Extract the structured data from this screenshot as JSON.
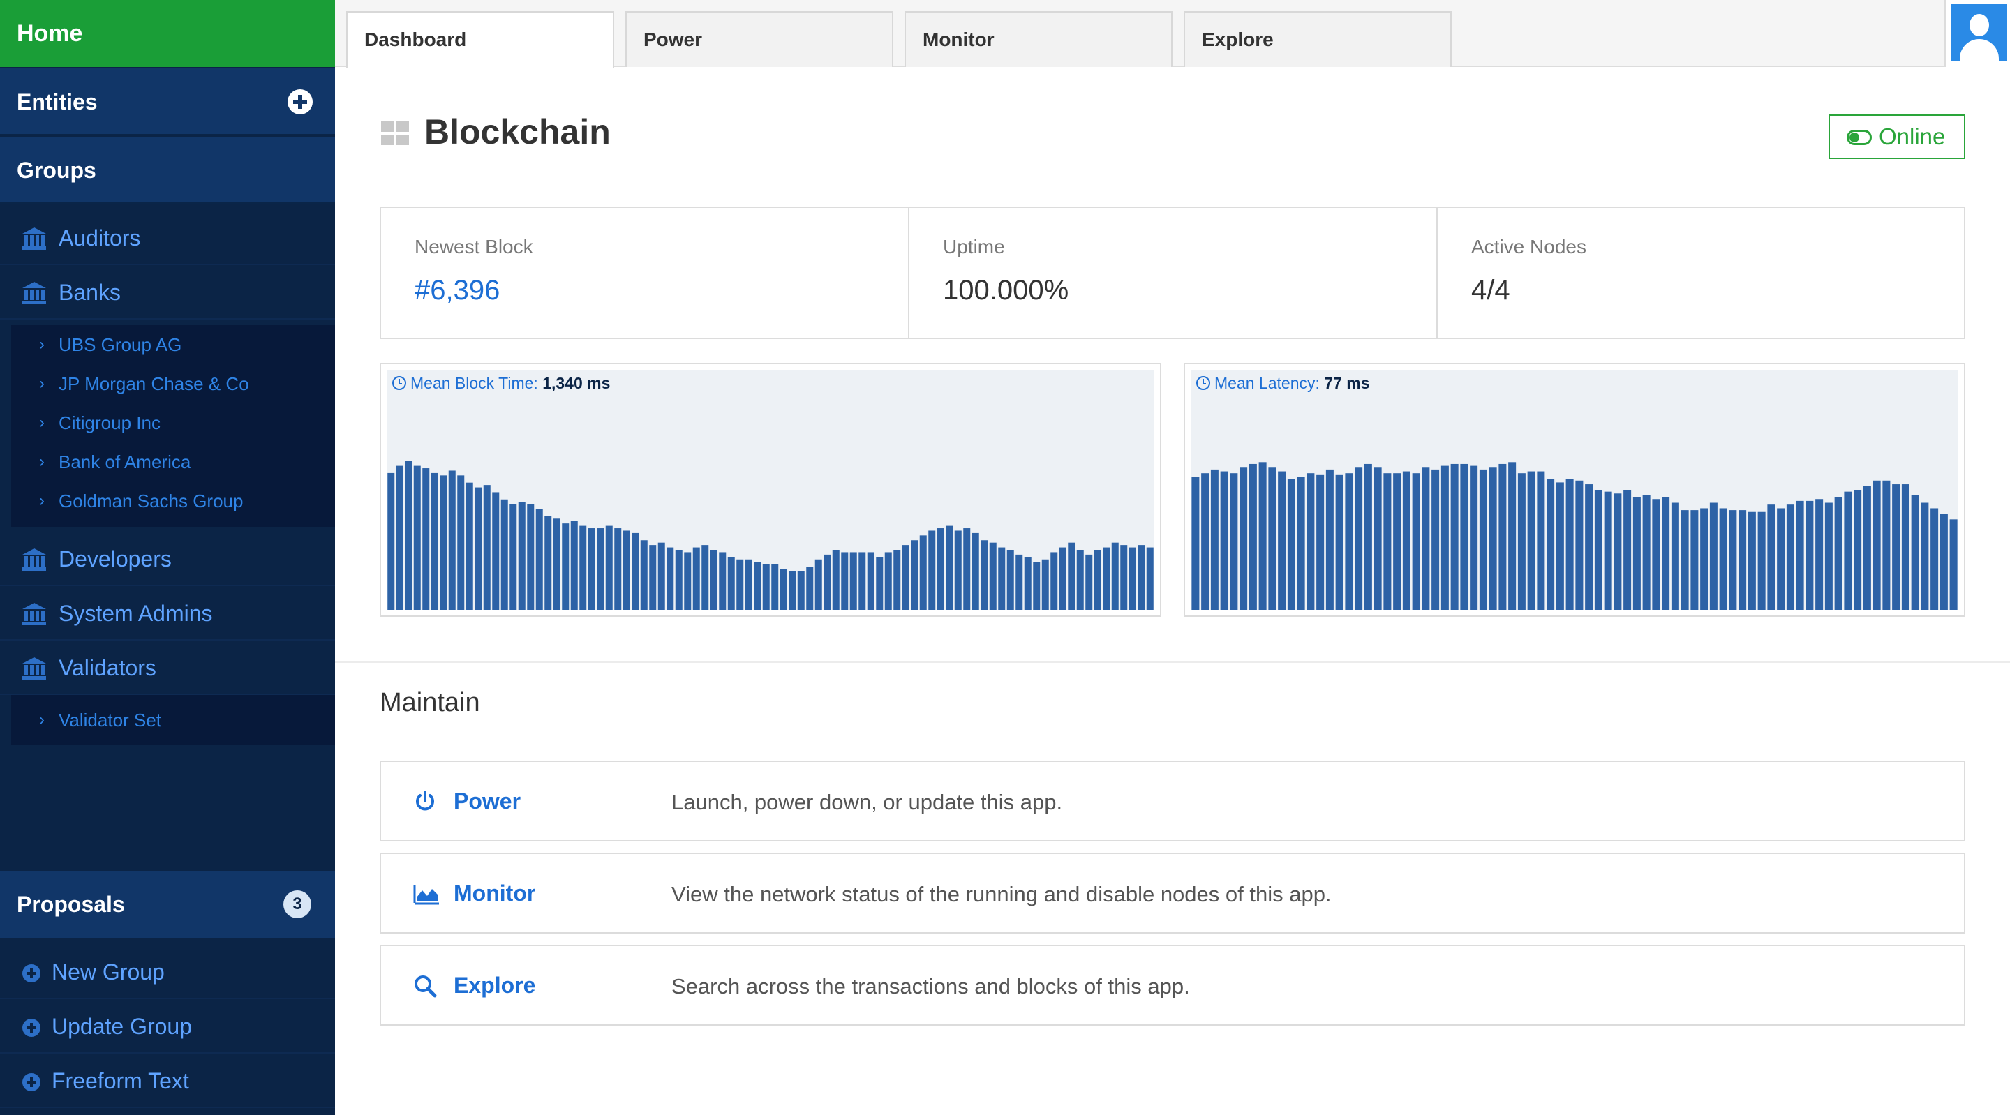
{
  "sidebar": {
    "home": "Home",
    "entities": "Entities",
    "groups": "Groups",
    "items": [
      {
        "label": "Auditors"
      },
      {
        "label": "Banks",
        "children": [
          "UBS Group AG",
          "JP Morgan Chase & Co",
          "Citigroup Inc",
          "Bank of America",
          "Goldman Sachs Group"
        ]
      },
      {
        "label": "Developers"
      },
      {
        "label": "System Admins"
      },
      {
        "label": "Validators",
        "children": [
          "Validator Set"
        ]
      }
    ],
    "proposals": {
      "label": "Proposals",
      "count": "3"
    },
    "proposal_items": [
      "New Group",
      "Update Group",
      "Freeform Text"
    ]
  },
  "tabs": [
    "Dashboard",
    "Power",
    "Monitor",
    "Explore"
  ],
  "active_tab": "Dashboard",
  "page": {
    "title": "Blockchain",
    "status": "Online",
    "status_color": "#2aa53a"
  },
  "stats": [
    {
      "label": "Newest Block",
      "value": "#6,396"
    },
    {
      "label": "Uptime",
      "value": "100.000%"
    },
    {
      "label": "Active Nodes",
      "value": "4/4"
    }
  ],
  "chart_data": [
    {
      "type": "bar",
      "title": "Mean Block Time:",
      "value_label": "1,340 ms",
      "color": "#2d62a6",
      "values": [
        57,
        60,
        62,
        60,
        59,
        57,
        56,
        58,
        56,
        53,
        51,
        52,
        49,
        46,
        44,
        45,
        44,
        42,
        39,
        38,
        36,
        37,
        35,
        34,
        34,
        35,
        34,
        33,
        32,
        29,
        27,
        28,
        26,
        25,
        24,
        26,
        27,
        25,
        24,
        22,
        21,
        21,
        20,
        19,
        19,
        17,
        16,
        16,
        18,
        21,
        23,
        25,
        24,
        24,
        24,
        24,
        22,
        24,
        25,
        27,
        29,
        31,
        33,
        34,
        35,
        33,
        34,
        32,
        29,
        28,
        26,
        25,
        23,
        22,
        20,
        21,
        24,
        26,
        28,
        25,
        23,
        25,
        26,
        28,
        27,
        26,
        27,
        26
      ],
      "ylim": [
        0,
        100
      ]
    },
    {
      "type": "bar",
      "title": "Mean Latency:",
      "value_label": "77 ms",
      "color": "#2d62a6",
      "values": [
        72,
        74,
        76,
        75,
        74,
        77,
        79,
        80,
        77,
        75,
        71,
        72,
        74,
        73,
        76,
        73,
        74,
        77,
        79,
        77,
        74,
        74,
        75,
        74,
        77,
        76,
        78,
        79,
        79,
        78,
        76,
        77,
        79,
        80,
        74,
        75,
        75,
        71,
        69,
        71,
        70,
        68,
        65,
        64,
        63,
        65,
        61,
        62,
        60,
        61,
        58,
        54,
        54,
        55,
        58,
        55,
        54,
        54,
        53,
        53,
        57,
        55,
        57,
        59,
        59,
        60,
        58,
        61,
        64,
        65,
        67,
        70,
        70,
        68,
        68,
        62,
        58,
        55,
        52,
        49
      ],
      "ylim": [
        0,
        130
      ]
    }
  ],
  "maintain": {
    "title": "Maintain",
    "actions": [
      {
        "name": "Power",
        "icon": "power-icon",
        "desc": "Launch, power down, or update this app."
      },
      {
        "name": "Monitor",
        "icon": "area-chart-icon",
        "desc": "View the network status of the running and disable nodes of this app."
      },
      {
        "name": "Explore",
        "icon": "search-icon",
        "desc": "Search across the transactions and blocks of this app."
      }
    ]
  }
}
